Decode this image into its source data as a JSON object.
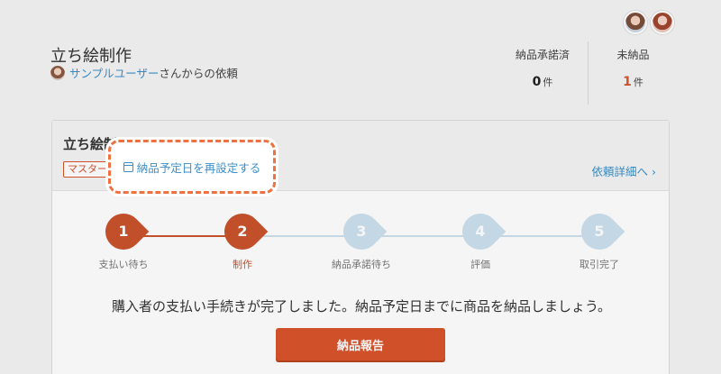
{
  "header": {
    "title": "立ち絵制作",
    "requester_user": "サンプルユーザー",
    "requester_suffix": "さんからの依頼"
  },
  "stats": [
    {
      "label": "納品承諾済",
      "value": "0",
      "unit": "件",
      "color": "#222222"
    },
    {
      "label": "未納品",
      "value": "1",
      "unit": "件",
      "color": "#d9542b"
    }
  ],
  "card": {
    "title": "立ち絵制作",
    "tag": "マスター",
    "reschedule_link": "納品予定日を再設定する",
    "detail_link": "依頼詳細へ ›"
  },
  "steps": [
    {
      "num": "1",
      "label": "支払い待ち",
      "state": "done"
    },
    {
      "num": "2",
      "label": "制作",
      "state": "current"
    },
    {
      "num": "3",
      "label": "納品承諾待ち",
      "state": "todo"
    },
    {
      "num": "4",
      "label": "評価",
      "state": "todo"
    },
    {
      "num": "5",
      "label": "取引完了",
      "state": "todo"
    }
  ],
  "message": "購入者の支払い手続きが完了しました。納品予定日までに商品を納品しましょう。",
  "primary_button": "納品報告",
  "colors": {
    "accent": "#d9542b",
    "link": "#3a8fc9",
    "track": "#cde0ee"
  }
}
